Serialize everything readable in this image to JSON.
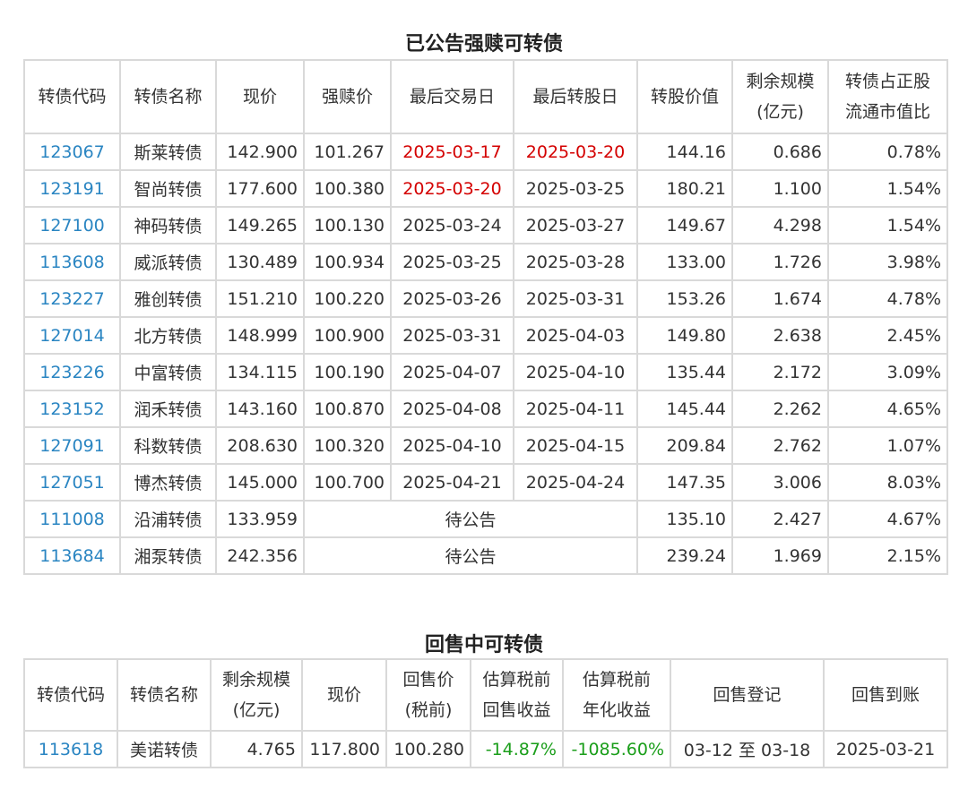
{
  "table1": {
    "title": "已公告强赎可转债",
    "headers": {
      "code": "转债代码",
      "name": "转债名称",
      "price": "现价",
      "redeem_price": "强赎价",
      "last_trade": "最后交易日",
      "last_convert": "最后转股日",
      "convert_value": "转股价值",
      "remaining_l1": "剩余规模",
      "remaining_l2": "(亿元)",
      "ratio_l1": "转债占正股",
      "ratio_l2": "流通市值比"
    },
    "rows": [
      {
        "code": "123067",
        "name": "斯莱转债",
        "price": "142.900",
        "redeem": "101.267",
        "last_trade": "2025-03-17",
        "last_convert": "2025-03-20",
        "value": "144.16",
        "remaining": "0.686",
        "ratio": "0.78%"
      },
      {
        "code": "123191",
        "name": "智尚转债",
        "price": "177.600",
        "redeem": "100.380",
        "last_trade": "2025-03-20",
        "last_convert": "2025-03-25",
        "value": "180.21",
        "remaining": "1.100",
        "ratio": "1.54%"
      },
      {
        "code": "127100",
        "name": "神码转债",
        "price": "149.265",
        "redeem": "100.130",
        "last_trade": "2025-03-24",
        "last_convert": "2025-03-27",
        "value": "149.67",
        "remaining": "4.298",
        "ratio": "1.54%"
      },
      {
        "code": "113608",
        "name": "威派转债",
        "price": "130.489",
        "redeem": "100.934",
        "last_trade": "2025-03-25",
        "last_convert": "2025-03-28",
        "value": "133.00",
        "remaining": "1.726",
        "ratio": "3.98%"
      },
      {
        "code": "123227",
        "name": "雅创转债",
        "price": "151.210",
        "redeem": "100.220",
        "last_trade": "2025-03-26",
        "last_convert": "2025-03-31",
        "value": "153.26",
        "remaining": "1.674",
        "ratio": "4.78%"
      },
      {
        "code": "127014",
        "name": "北方转债",
        "price": "148.999",
        "redeem": "100.900",
        "last_trade": "2025-03-31",
        "last_convert": "2025-04-03",
        "value": "149.80",
        "remaining": "2.638",
        "ratio": "2.45%"
      },
      {
        "code": "123226",
        "name": "中富转债",
        "price": "134.115",
        "redeem": "100.190",
        "last_trade": "2025-04-07",
        "last_convert": "2025-04-10",
        "value": "135.44",
        "remaining": "2.172",
        "ratio": "3.09%"
      },
      {
        "code": "123152",
        "name": "润禾转债",
        "price": "143.160",
        "redeem": "100.870",
        "last_trade": "2025-04-08",
        "last_convert": "2025-04-11",
        "value": "145.44",
        "remaining": "2.262",
        "ratio": "4.65%"
      },
      {
        "code": "127091",
        "name": "科数转债",
        "price": "208.630",
        "redeem": "100.320",
        "last_trade": "2025-04-10",
        "last_convert": "2025-04-15",
        "value": "209.84",
        "remaining": "2.762",
        "ratio": "1.07%"
      },
      {
        "code": "127051",
        "name": "博杰转债",
        "price": "145.000",
        "redeem": "100.700",
        "last_trade": "2025-04-21",
        "last_convert": "2025-04-24",
        "value": "147.35",
        "remaining": "3.006",
        "ratio": "8.03%"
      },
      {
        "code": "111008",
        "name": "沿浦转债",
        "price": "133.959",
        "pending": "待公告",
        "value": "135.10",
        "remaining": "2.427",
        "ratio": "4.67%"
      },
      {
        "code": "113684",
        "name": "湘泵转债",
        "price": "242.356",
        "pending": "待公告",
        "value": "239.24",
        "remaining": "1.969",
        "ratio": "2.15%"
      }
    ]
  },
  "table2": {
    "title": "回售中可转债",
    "headers": {
      "code": "转债代码",
      "name": "转债名称",
      "remaining_l1": "剩余规模",
      "remaining_l2": "(亿元)",
      "price": "现价",
      "putback_l1": "回售价",
      "putback_l2": "(税前)",
      "est_yield_l1": "估算税前",
      "est_yield_l2": "回售收益",
      "annual_l1": "估算税前",
      "annual_l2": "年化收益",
      "register": "回售登记",
      "arrival": "回售到账"
    },
    "row": {
      "code": "113618",
      "name": "美诺转债",
      "remaining": "4.765",
      "price": "117.800",
      "putback": "100.280",
      "est_yield": "-14.87%",
      "annual": "-1085.60%",
      "register": "03-12 至 03-18",
      "arrival": "2025-03-21"
    }
  },
  "colors": {
    "code_link": "#2a85c2",
    "highlight_date": "#d40000",
    "negative_yield": "#1a9e1a",
    "border": "#d9d9d9"
  }
}
